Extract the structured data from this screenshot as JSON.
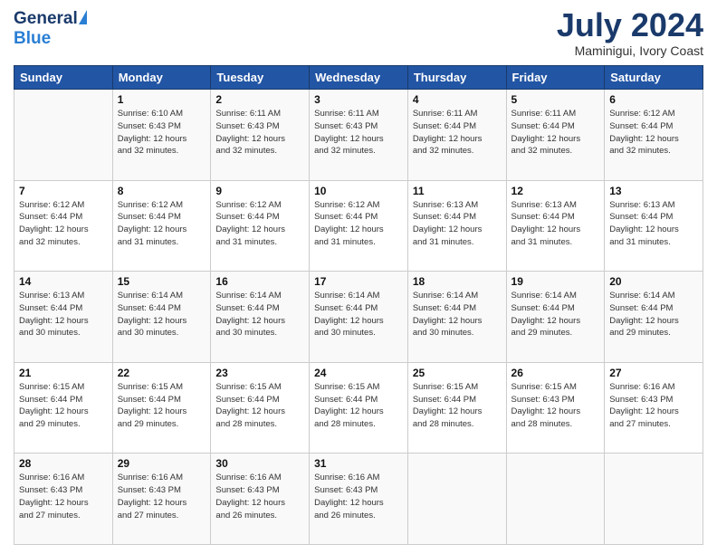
{
  "header": {
    "logo_general": "General",
    "logo_blue": "Blue",
    "month_title": "July 2024",
    "location": "Maminigui, Ivory Coast"
  },
  "days_of_week": [
    "Sunday",
    "Monday",
    "Tuesday",
    "Wednesday",
    "Thursday",
    "Friday",
    "Saturday"
  ],
  "weeks": [
    [
      {
        "num": "",
        "sunrise": "",
        "sunset": "",
        "daylight": ""
      },
      {
        "num": "1",
        "sunrise": "Sunrise: 6:10 AM",
        "sunset": "Sunset: 6:43 PM",
        "daylight": "Daylight: 12 hours and 32 minutes."
      },
      {
        "num": "2",
        "sunrise": "Sunrise: 6:11 AM",
        "sunset": "Sunset: 6:43 PM",
        "daylight": "Daylight: 12 hours and 32 minutes."
      },
      {
        "num": "3",
        "sunrise": "Sunrise: 6:11 AM",
        "sunset": "Sunset: 6:43 PM",
        "daylight": "Daylight: 12 hours and 32 minutes."
      },
      {
        "num": "4",
        "sunrise": "Sunrise: 6:11 AM",
        "sunset": "Sunset: 6:44 PM",
        "daylight": "Daylight: 12 hours and 32 minutes."
      },
      {
        "num": "5",
        "sunrise": "Sunrise: 6:11 AM",
        "sunset": "Sunset: 6:44 PM",
        "daylight": "Daylight: 12 hours and 32 minutes."
      },
      {
        "num": "6",
        "sunrise": "Sunrise: 6:12 AM",
        "sunset": "Sunset: 6:44 PM",
        "daylight": "Daylight: 12 hours and 32 minutes."
      }
    ],
    [
      {
        "num": "7",
        "sunrise": "Sunrise: 6:12 AM",
        "sunset": "Sunset: 6:44 PM",
        "daylight": "Daylight: 12 hours and 32 minutes."
      },
      {
        "num": "8",
        "sunrise": "Sunrise: 6:12 AM",
        "sunset": "Sunset: 6:44 PM",
        "daylight": "Daylight: 12 hours and 31 minutes."
      },
      {
        "num": "9",
        "sunrise": "Sunrise: 6:12 AM",
        "sunset": "Sunset: 6:44 PM",
        "daylight": "Daylight: 12 hours and 31 minutes."
      },
      {
        "num": "10",
        "sunrise": "Sunrise: 6:12 AM",
        "sunset": "Sunset: 6:44 PM",
        "daylight": "Daylight: 12 hours and 31 minutes."
      },
      {
        "num": "11",
        "sunrise": "Sunrise: 6:13 AM",
        "sunset": "Sunset: 6:44 PM",
        "daylight": "Daylight: 12 hours and 31 minutes."
      },
      {
        "num": "12",
        "sunrise": "Sunrise: 6:13 AM",
        "sunset": "Sunset: 6:44 PM",
        "daylight": "Daylight: 12 hours and 31 minutes."
      },
      {
        "num": "13",
        "sunrise": "Sunrise: 6:13 AM",
        "sunset": "Sunset: 6:44 PM",
        "daylight": "Daylight: 12 hours and 31 minutes."
      }
    ],
    [
      {
        "num": "14",
        "sunrise": "Sunrise: 6:13 AM",
        "sunset": "Sunset: 6:44 PM",
        "daylight": "Daylight: 12 hours and 30 minutes."
      },
      {
        "num": "15",
        "sunrise": "Sunrise: 6:14 AM",
        "sunset": "Sunset: 6:44 PM",
        "daylight": "Daylight: 12 hours and 30 minutes."
      },
      {
        "num": "16",
        "sunrise": "Sunrise: 6:14 AM",
        "sunset": "Sunset: 6:44 PM",
        "daylight": "Daylight: 12 hours and 30 minutes."
      },
      {
        "num": "17",
        "sunrise": "Sunrise: 6:14 AM",
        "sunset": "Sunset: 6:44 PM",
        "daylight": "Daylight: 12 hours and 30 minutes."
      },
      {
        "num": "18",
        "sunrise": "Sunrise: 6:14 AM",
        "sunset": "Sunset: 6:44 PM",
        "daylight": "Daylight: 12 hours and 30 minutes."
      },
      {
        "num": "19",
        "sunrise": "Sunrise: 6:14 AM",
        "sunset": "Sunset: 6:44 PM",
        "daylight": "Daylight: 12 hours and 29 minutes."
      },
      {
        "num": "20",
        "sunrise": "Sunrise: 6:14 AM",
        "sunset": "Sunset: 6:44 PM",
        "daylight": "Daylight: 12 hours and 29 minutes."
      }
    ],
    [
      {
        "num": "21",
        "sunrise": "Sunrise: 6:15 AM",
        "sunset": "Sunset: 6:44 PM",
        "daylight": "Daylight: 12 hours and 29 minutes."
      },
      {
        "num": "22",
        "sunrise": "Sunrise: 6:15 AM",
        "sunset": "Sunset: 6:44 PM",
        "daylight": "Daylight: 12 hours and 29 minutes."
      },
      {
        "num": "23",
        "sunrise": "Sunrise: 6:15 AM",
        "sunset": "Sunset: 6:44 PM",
        "daylight": "Daylight: 12 hours and 28 minutes."
      },
      {
        "num": "24",
        "sunrise": "Sunrise: 6:15 AM",
        "sunset": "Sunset: 6:44 PM",
        "daylight": "Daylight: 12 hours and 28 minutes."
      },
      {
        "num": "25",
        "sunrise": "Sunrise: 6:15 AM",
        "sunset": "Sunset: 6:44 PM",
        "daylight": "Daylight: 12 hours and 28 minutes."
      },
      {
        "num": "26",
        "sunrise": "Sunrise: 6:15 AM",
        "sunset": "Sunset: 6:43 PM",
        "daylight": "Daylight: 12 hours and 28 minutes."
      },
      {
        "num": "27",
        "sunrise": "Sunrise: 6:16 AM",
        "sunset": "Sunset: 6:43 PM",
        "daylight": "Daylight: 12 hours and 27 minutes."
      }
    ],
    [
      {
        "num": "28",
        "sunrise": "Sunrise: 6:16 AM",
        "sunset": "Sunset: 6:43 PM",
        "daylight": "Daylight: 12 hours and 27 minutes."
      },
      {
        "num": "29",
        "sunrise": "Sunrise: 6:16 AM",
        "sunset": "Sunset: 6:43 PM",
        "daylight": "Daylight: 12 hours and 27 minutes."
      },
      {
        "num": "30",
        "sunrise": "Sunrise: 6:16 AM",
        "sunset": "Sunset: 6:43 PM",
        "daylight": "Daylight: 12 hours and 26 minutes."
      },
      {
        "num": "31",
        "sunrise": "Sunrise: 6:16 AM",
        "sunset": "Sunset: 6:43 PM",
        "daylight": "Daylight: 12 hours and 26 minutes."
      },
      {
        "num": "",
        "sunrise": "",
        "sunset": "",
        "daylight": ""
      },
      {
        "num": "",
        "sunrise": "",
        "sunset": "",
        "daylight": ""
      },
      {
        "num": "",
        "sunrise": "",
        "sunset": "",
        "daylight": ""
      }
    ]
  ]
}
